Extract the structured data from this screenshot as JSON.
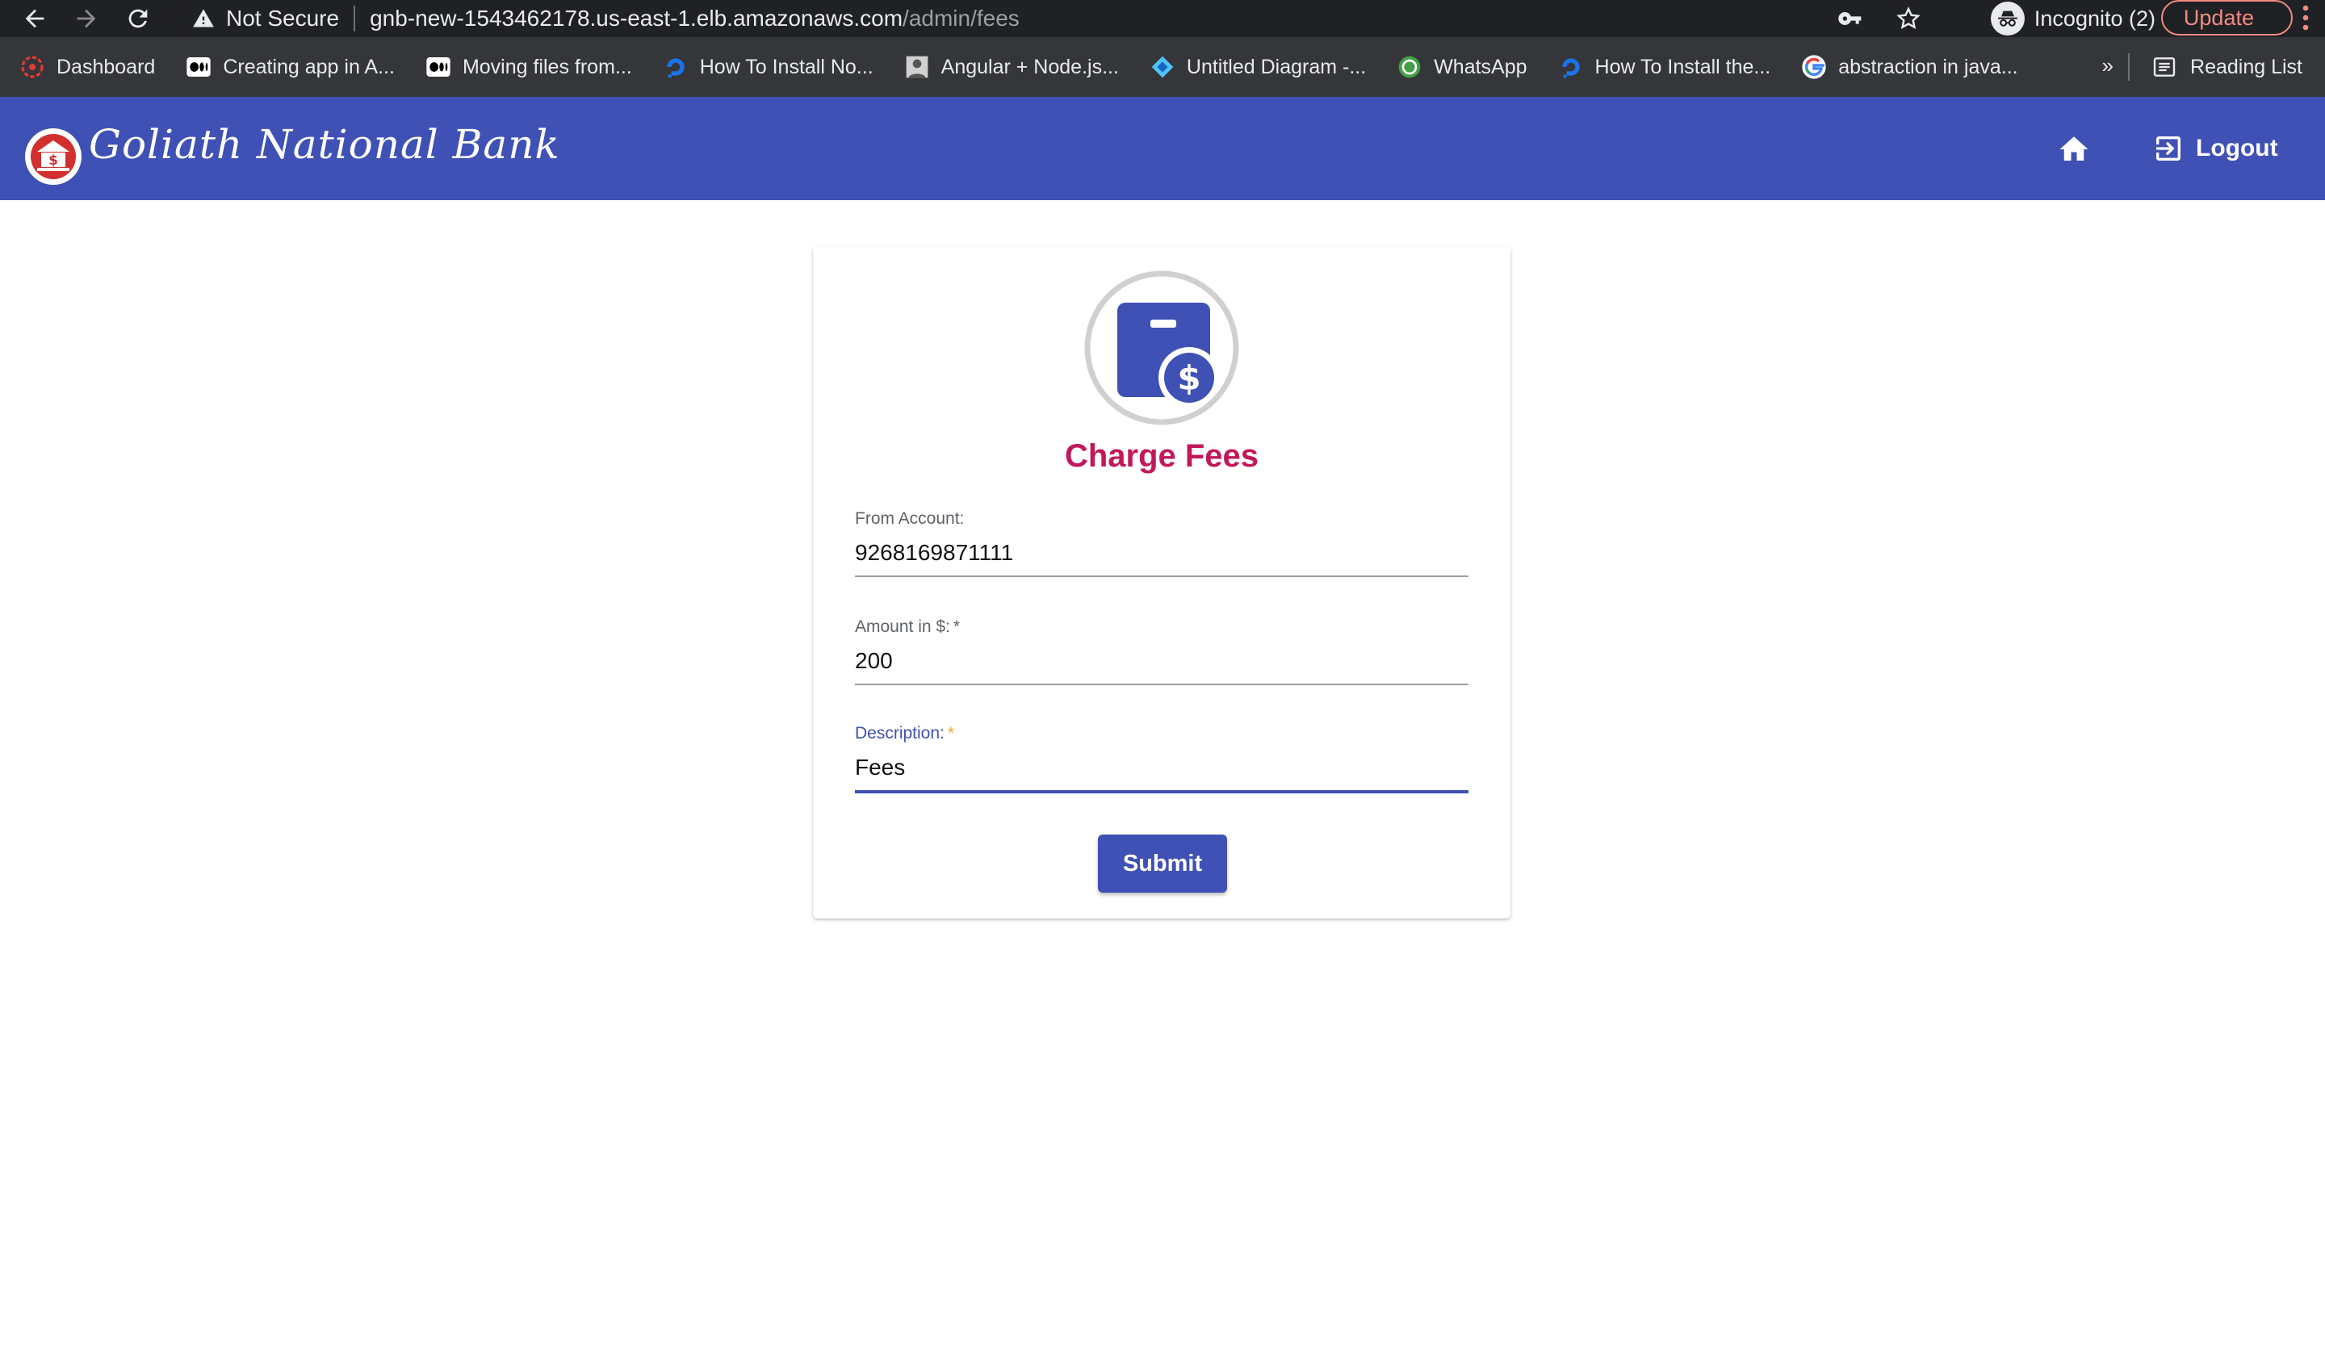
{
  "browser": {
    "security_label": "Not Secure",
    "url_host": "gnb-new-1543462178.us-east-1.elb.amazonaws.com",
    "url_path": "/admin/fees",
    "incognito_label": "Incognito (2)",
    "update_label": "Update",
    "bookmarks": [
      {
        "label": "Dashboard",
        "icon": "dashboard-icon"
      },
      {
        "label": "Creating app in A...",
        "icon": "medium-icon"
      },
      {
        "label": "Moving files from...",
        "icon": "medium-icon"
      },
      {
        "label": "How To Install No...",
        "icon": "digitalocean-icon"
      },
      {
        "label": "Angular + Node.js...",
        "icon": "avatar-icon"
      },
      {
        "label": "Untitled Diagram -...",
        "icon": "diagram-icon"
      },
      {
        "label": "WhatsApp",
        "icon": "whatsapp-icon"
      },
      {
        "label": "How To Install the...",
        "icon": "digitalocean-icon"
      },
      {
        "label": "abstraction in java...",
        "icon": "google-icon"
      }
    ],
    "more_label": "»",
    "reading_list_label": "Reading List"
  },
  "app": {
    "brand": "Goliath National Bank",
    "logout_label": "Logout"
  },
  "form": {
    "title": "Charge Fees",
    "from_account": {
      "label": "From Account:",
      "value": "9268169871111"
    },
    "amount": {
      "label": "Amount in $:",
      "required_mark": "*",
      "value": "200"
    },
    "description": {
      "label": "Description:",
      "required_mark": "*",
      "value": "Fees"
    },
    "submit_label": "Submit"
  },
  "colors": {
    "primary": "#3f51b5",
    "title_accent": "#c2185b",
    "required_focused": "#f9a825"
  }
}
